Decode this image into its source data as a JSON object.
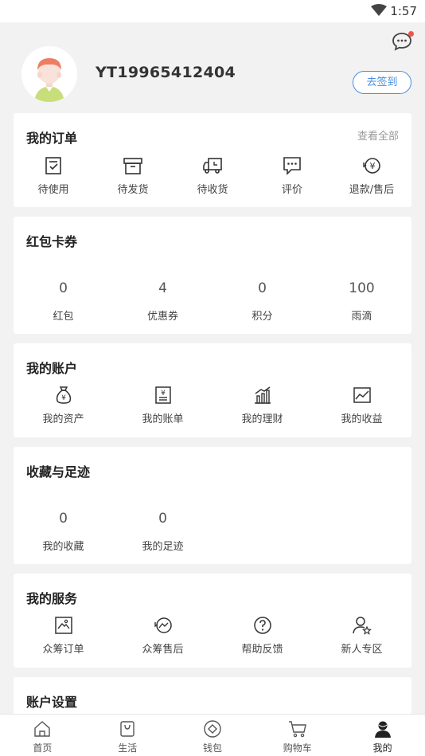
{
  "status_bar": {
    "time": "1:57"
  },
  "profile": {
    "username": "YT19965412404",
    "signin_label": "去签到"
  },
  "orders": {
    "title": "我的订单",
    "view_all": "查看全部",
    "items": [
      {
        "label": "待使用",
        "icon": "clipboard-check-icon"
      },
      {
        "label": "待发货",
        "icon": "box-icon"
      },
      {
        "label": "待收货",
        "icon": "truck-icon"
      },
      {
        "label": "评价",
        "icon": "comment-icon"
      },
      {
        "label": "退款/售后",
        "icon": "refund-icon"
      }
    ]
  },
  "coupons": {
    "title": "红包卡券",
    "items": [
      {
        "value": "0",
        "label": "红包"
      },
      {
        "value": "4",
        "label": "优惠券"
      },
      {
        "value": "0",
        "label": "积分"
      },
      {
        "value": "100",
        "label": "雨滴"
      }
    ]
  },
  "account": {
    "title": "我的账户",
    "items": [
      {
        "label": "我的资产",
        "icon": "money-bag-icon"
      },
      {
        "label": "我的账单",
        "icon": "bill-icon"
      },
      {
        "label": "我的理财",
        "icon": "bar-chart-icon"
      },
      {
        "label": "我的收益",
        "icon": "line-chart-icon"
      }
    ]
  },
  "favorites": {
    "title": "收藏与足迹",
    "items": [
      {
        "value": "0",
        "label": "我的收藏"
      },
      {
        "value": "0",
        "label": "我的足迹"
      }
    ]
  },
  "services": {
    "title": "我的服务",
    "items": [
      {
        "label": "众筹订单",
        "icon": "crowdfund-order-icon"
      },
      {
        "label": "众筹售后",
        "icon": "crowdfund-service-icon"
      },
      {
        "label": "帮助反馈",
        "icon": "help-icon"
      },
      {
        "label": "新人专区",
        "icon": "new-user-icon"
      }
    ]
  },
  "settings": {
    "title": "账户设置"
  },
  "tabbar": {
    "items": [
      {
        "label": "首页",
        "icon": "home-icon"
      },
      {
        "label": "生活",
        "icon": "shopping-bag-icon"
      },
      {
        "label": "钱包",
        "icon": "wallet-icon"
      },
      {
        "label": "购物车",
        "icon": "cart-icon"
      },
      {
        "label": "我的",
        "icon": "person-icon",
        "active": true
      }
    ]
  },
  "colors": {
    "accent": "#4a8fe0",
    "background": "#f2f2f2",
    "badge": "#f0554a"
  }
}
